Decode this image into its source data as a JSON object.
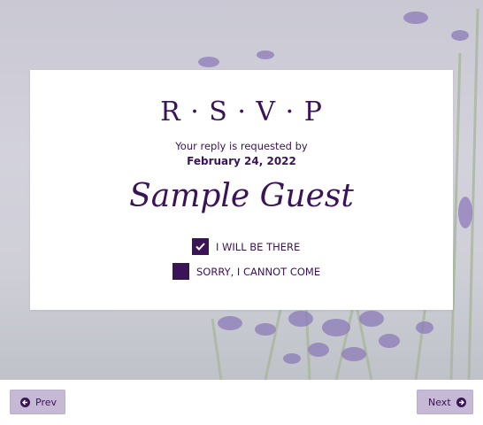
{
  "card": {
    "title": "R · S · V · P",
    "request_text": "Your reply is requested by",
    "date": "February 24, 2022",
    "guest_name": "Sample Guest"
  },
  "options": [
    {
      "label": "I WILL BE THERE",
      "checked": true
    },
    {
      "label": "SORRY, I CANNOT COME",
      "checked": false
    }
  ],
  "nav": {
    "prev_label": "Prev",
    "next_label": "Next",
    "prev_icon": "arrow-circle-left-icon",
    "next_icon": "arrow-circle-right-icon"
  },
  "colors": {
    "accent": "#3b1357",
    "button_bg": "#c5b9d6"
  }
}
